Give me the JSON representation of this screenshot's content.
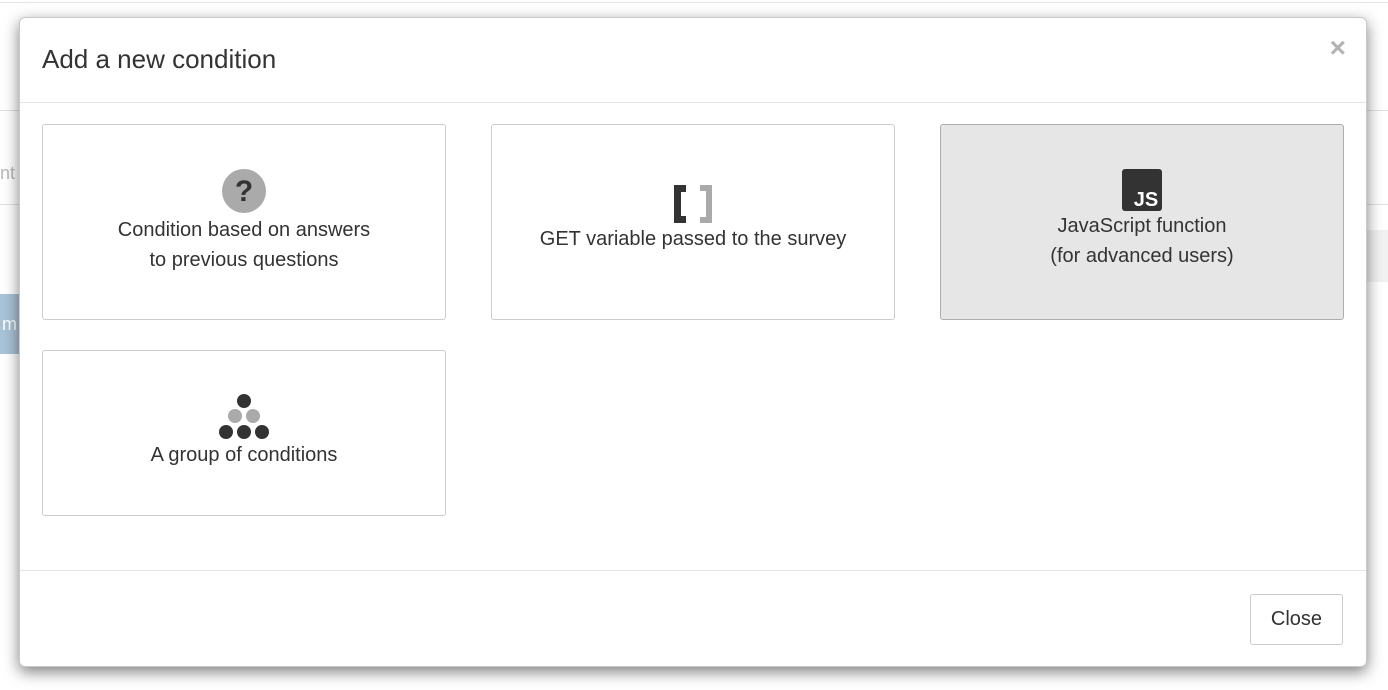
{
  "modal": {
    "title": "Add a new condition",
    "close_symbol": "×",
    "close_button_label": "Close"
  },
  "options": [
    {
      "label": "Condition based on answers\nto previous questions",
      "icon": "question-circle-icon",
      "selected": false
    },
    {
      "label": "GET variable passed to the survey",
      "icon": "brackets-icon",
      "selected": false
    },
    {
      "label": "JavaScript function\n(for advanced users)",
      "icon": "js-icon",
      "selected": true
    },
    {
      "label": "A group of conditions",
      "icon": "dots-group-icon",
      "selected": false
    }
  ],
  "icons": {
    "js_text": "JS",
    "question_text": "?"
  },
  "background": {
    "left_fragment": "nt",
    "blue_fragment": "m"
  },
  "colors": {
    "selected_tile": "#e6e6e6",
    "icon_dark": "#333333",
    "icon_gray": "#aaaaaa"
  }
}
